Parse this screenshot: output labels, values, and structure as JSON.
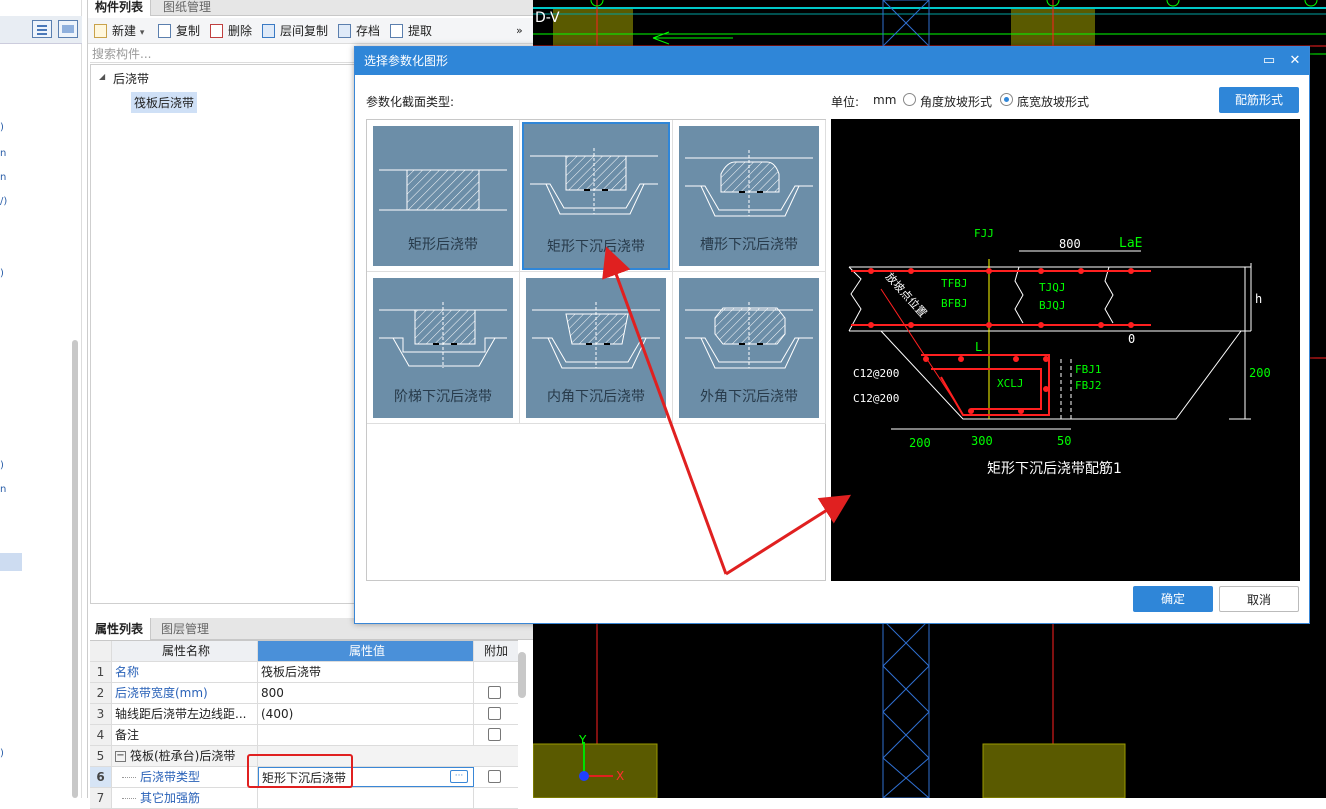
{
  "left_panel": {
    "tabs": [
      "构件列表",
      "图纸管理"
    ],
    "toolbar": {
      "new": "新建",
      "new_arrow": "▾",
      "copy": "复制",
      "delete": "删除",
      "layer_copy": "层间复制",
      "save": "存档",
      "extract": "提取",
      "more": "»"
    },
    "search_placeholder": "搜索构件...",
    "tree": {
      "root_toggle": "◢",
      "root": "后浇带",
      "child": "筏板后浇带"
    }
  },
  "left_strip_marks": [
    ")",
    "n",
    "n",
    "/)",
    ")",
    ")",
    "n",
    ")"
  ],
  "attr_panel": {
    "tabs": [
      "属性列表",
      "图层管理"
    ],
    "headers": {
      "name": "属性名称",
      "value": "属性值",
      "extra": "附加"
    },
    "rows": [
      {
        "no": "1",
        "name": "名称",
        "value": "筏板后浇带",
        "check": false,
        "blue": true
      },
      {
        "no": "2",
        "name": "后浇带宽度(mm)",
        "value": "800",
        "check": true,
        "blue": true
      },
      {
        "no": "3",
        "name": "轴线距后浇带左边线距...",
        "value": "(400)",
        "check": true,
        "blue": false
      },
      {
        "no": "4",
        "name": "备注",
        "value": "",
        "check": true,
        "blue": false
      },
      {
        "no": "5",
        "name": "筏板(桩承台)后浇带",
        "value": "",
        "check": false,
        "blue": false,
        "group": true
      },
      {
        "no": "6",
        "name": "后浇带类型",
        "value": "矩形下沉后浇带",
        "check": true,
        "blue": true,
        "indent": true,
        "selected": true
      },
      {
        "no": "7",
        "name": "其它加强筋",
        "value": "",
        "check": false,
        "blue": true,
        "indent": true
      }
    ],
    "group_toggle": "−",
    "ellipsis": "···"
  },
  "cad": {
    "top_label": "D-V",
    "axis_y": "Y",
    "axis_x": "X"
  },
  "dialog": {
    "title": "选择参数化图形",
    "maximize": "▭",
    "close": "✕",
    "section_label": "参数化截面类型:",
    "unit_label": "单位:",
    "unit": "mm",
    "radio_angle": "角度放坡形式",
    "radio_width": "底宽放坡形式",
    "rebar_button": "配筋形式",
    "ok": "确定",
    "cancel": "取消",
    "shapes": [
      {
        "label": "矩形后浇带",
        "kind": "rect"
      },
      {
        "label": "矩形下沉后浇带",
        "kind": "sink-rect"
      },
      {
        "label": "槽形下沉后浇带",
        "kind": "trough"
      },
      {
        "label": "阶梯下沉后浇带",
        "kind": "step"
      },
      {
        "label": "内角下沉后浇带",
        "kind": "inner"
      },
      {
        "label": "外角下沉后浇带",
        "kind": "outer"
      }
    ],
    "preview": {
      "caption": "矩形下沉后浇带配筋1",
      "labels": {
        "fjj": "FJJ",
        "w800": "800",
        "lae": "LaE",
        "tfbj": "TFBJ",
        "tjqj": "TJQJ",
        "bfbj": "BFBJ",
        "bjqj": "BJQJ",
        "h": "h",
        "zero": "0",
        "l": "L",
        "fbj1": "FBJ1",
        "fbj2": "FBJ2",
        "xclj": "XCLJ",
        "c12a": "C12@200",
        "c12b": "C12@200",
        "d200r": "200",
        "d200": "200",
        "d300": "300",
        "d50": "50",
        "slope": "放坡点位置"
      }
    }
  },
  "colors": {
    "dialog_blue": "#2f86d8",
    "thumb_bg": "#6c8ea8",
    "annotation_red": "#e02020",
    "cad_green": "#00ff00",
    "cad_red": "#ff2020",
    "cad_olive": "#5a5a00"
  }
}
